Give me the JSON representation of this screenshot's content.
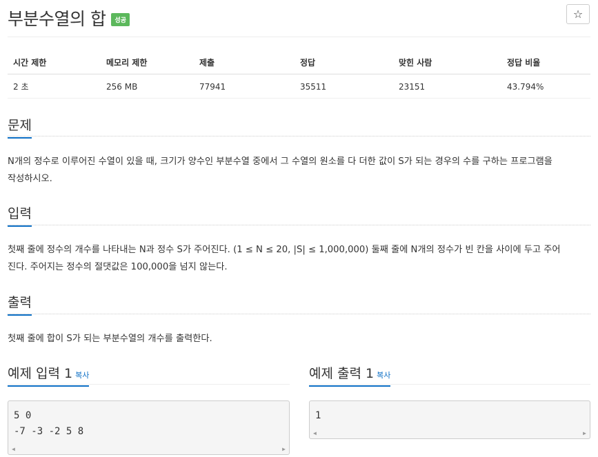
{
  "problem": {
    "title": "부분수열의 합",
    "status_badge": "성공",
    "star_icon": "☆"
  },
  "info_table": {
    "headers": [
      "시간 제한",
      "메모리 제한",
      "제출",
      "정답",
      "맞힌 사람",
      "정답 비율"
    ],
    "values": [
      "2 초",
      "256 MB",
      "77941",
      "35511",
      "23151",
      "43.794%"
    ]
  },
  "sections": {
    "description": {
      "heading": "문제",
      "lines": [
        "N개의 정수로 이루어진 수열이 있을 때, 크기가 양수인 부분수열 중에서 그 수열의 원소를 다 더한 값이 S가 되는 경우의 수를 구하는 프로그램을",
        "작성하시오."
      ]
    },
    "input": {
      "heading": "입력",
      "lines": [
        "첫째 줄에 정수의 개수를 나타내는 N과 정수 S가 주어진다. (1 ≤ N ≤ 20, |S| ≤ 1,000,000) 둘째 줄에 N개의 정수가 빈 칸을 사이에 두고 주어",
        "진다. 주어지는 정수의 절댓값은 100,000을 넘지 않는다."
      ]
    },
    "output": {
      "heading": "출력",
      "lines": [
        "첫째 줄에 합이 S가 되는 부분수열의 개수를 출력한다."
      ]
    }
  },
  "examples": {
    "input": {
      "heading": "예제 입력 1",
      "copy_label": "복사",
      "content": "5 0\n-7 -3 -2 5 8"
    },
    "output": {
      "heading": "예제 출력 1",
      "copy_label": "복사",
      "content": "1"
    }
  },
  "colors": {
    "accent": "#0b6ec5",
    "success_badge": "#5cb85c"
  }
}
